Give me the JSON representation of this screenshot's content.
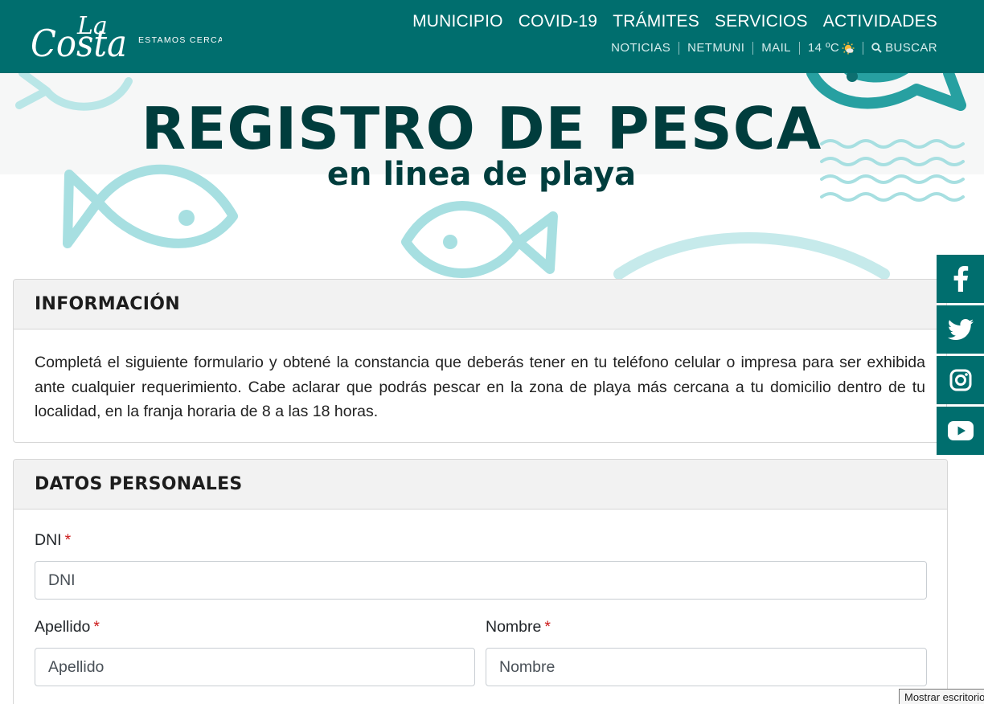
{
  "brand": {
    "logo_text_la": "La",
    "logo_text_costa": "Costa",
    "tagline": "ESTAMOS CERCA"
  },
  "nav": {
    "main": [
      "MUNICIPIO",
      "COVID-19",
      "TRÁMITES",
      "SERVICIOS",
      "ACTIVIDADES"
    ],
    "noticias": "NOTICIAS",
    "netmuni": "NETMUNI",
    "mail": "MAIL",
    "weather": "14 ºC",
    "search": "BUSCAR"
  },
  "banner": {
    "title": "REGISTRO DE PESCA",
    "subtitle": "en linea de playa"
  },
  "info": {
    "heading": "INFORMACIÓN",
    "text": "Completá el siguiente formulario y obtené la constancia que deberás tener en tu teléfono celular o impresa para ser exhibida ante cualquier requerimiento. Cabe aclarar que podrás pescar en la zona de playa más cercana a tu domicilio dentro de tu localidad, en la franja horaria de 8 a las 18 horas."
  },
  "form": {
    "heading": "DATOS PERSONALES",
    "required_mark": "*",
    "dni": {
      "label": "DNI",
      "placeholder": "DNI"
    },
    "apellido": {
      "label": "Apellido",
      "placeholder": "Apellido"
    },
    "nombre": {
      "label": "Nombre",
      "placeholder": "Nombre"
    }
  },
  "social": [
    "facebook-icon",
    "twitter-icon",
    "instagram-icon",
    "youtube-icon"
  ],
  "tooltip": "Mostrar escritorio",
  "colors": {
    "brand_teal": "#006e6e",
    "title_dark": "#003d3d",
    "fish_light": "#8fd6d8",
    "required_red": "#cc1b1b"
  }
}
